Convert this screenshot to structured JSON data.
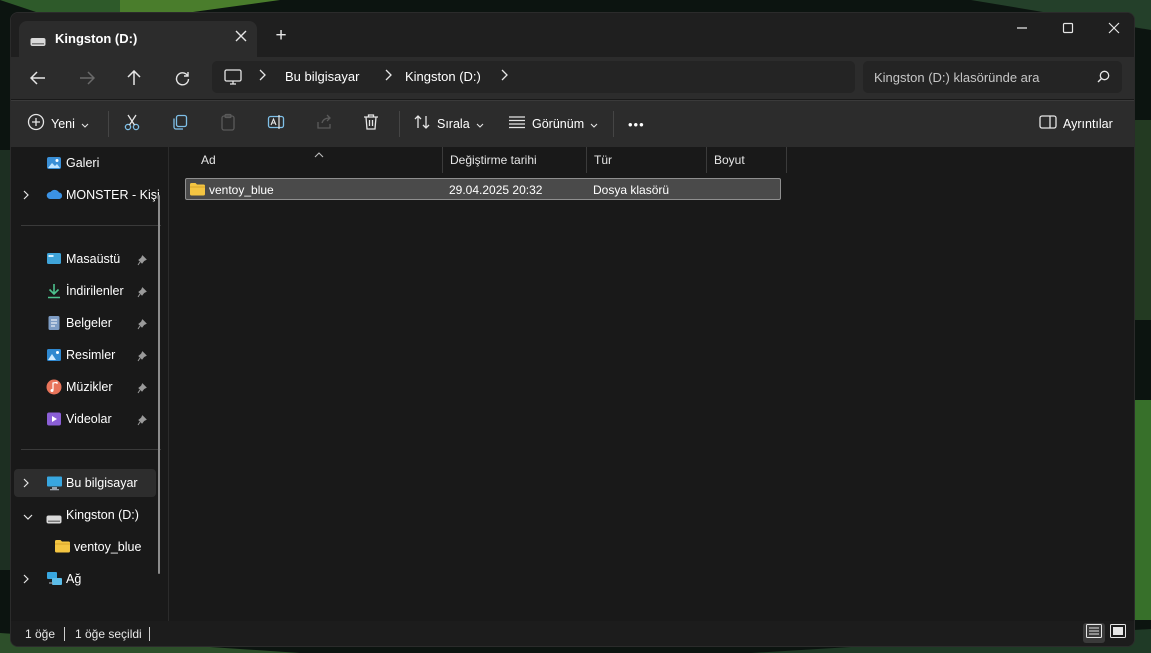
{
  "window": {
    "tab_title": "Kingston (D:)",
    "new_tab_symbol": "+"
  },
  "nav": {
    "breadcrumb": [
      "Bu bilgisayar",
      "Kingston (D:)"
    ],
    "search_placeholder": "Kingston (D:) klasöründe ara"
  },
  "toolbar": {
    "new_label": "Yeni",
    "sort_label": "Sırala",
    "view_label": "Görünüm",
    "details_label": "Ayrıntılar",
    "more_symbol": "•••"
  },
  "sidebar": {
    "items": [
      {
        "label": "Galeri",
        "icon": "gallery-icon",
        "expandable": false,
        "pinned": false
      },
      {
        "label": "MONSTER - Kişi",
        "icon": "onedrive-cloud-icon",
        "expandable": true,
        "pinned": false
      },
      {
        "label": "Masaüstü",
        "icon": "desktop-icon",
        "expandable": false,
        "pinned": true
      },
      {
        "label": "İndirilenler",
        "icon": "download-icon",
        "expandable": false,
        "pinned": true
      },
      {
        "label": "Belgeler",
        "icon": "documents-icon",
        "expandable": false,
        "pinned": true
      },
      {
        "label": "Resimler",
        "icon": "pictures-icon",
        "expandable": false,
        "pinned": true
      },
      {
        "label": "Müzikler",
        "icon": "music-icon",
        "expandable": false,
        "pinned": true
      },
      {
        "label": "Videolar",
        "icon": "videos-icon",
        "expandable": false,
        "pinned": true
      },
      {
        "label": "Bu bilgisayar",
        "icon": "computer-icon",
        "expandable": true,
        "selected": true
      },
      {
        "label": "Kingston (D:)",
        "icon": "drive-icon",
        "expandable": true,
        "expanded": true
      },
      {
        "label": "ventoy_blue",
        "icon": "folder-icon",
        "expandable": false
      },
      {
        "label": "Ağ",
        "icon": "network-icon",
        "expandable": true
      }
    ]
  },
  "columns": [
    "Ad",
    "Değiştirme tarihi",
    "Tür",
    "Boyut"
  ],
  "files": [
    {
      "name": "ventoy_blue",
      "modified": "29.04.2025 20:32",
      "type": "Dosya klasörü",
      "size": ""
    }
  ],
  "status": {
    "item_count": "1 öğe",
    "selected_count": "1 öğe seçildi"
  },
  "colors": {
    "window_bg": "#191919",
    "bar_bg": "#2c2c2c",
    "folder": "#f4c542",
    "selection_bg": "#4a4a4a"
  }
}
